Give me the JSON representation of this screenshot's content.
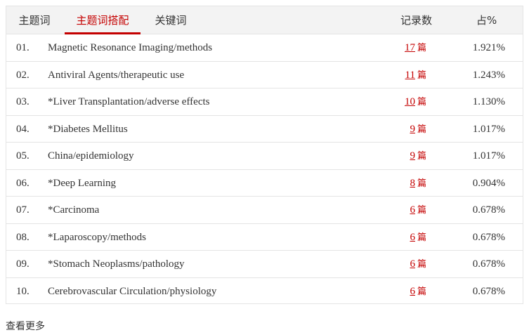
{
  "tabs": [
    {
      "label": "主题词"
    },
    {
      "label": "主题词搭配"
    },
    {
      "label": "关键词"
    }
  ],
  "columns": {
    "count": "记录数",
    "percent": "占%"
  },
  "unit": "篇",
  "rows": [
    {
      "num": "01.",
      "term": "Magnetic Resonance Imaging/methods",
      "count": "17",
      "pct": "1.921%"
    },
    {
      "num": "02.",
      "term": "Antiviral Agents/therapeutic use",
      "count": "11",
      "pct": "1.243%"
    },
    {
      "num": "03.",
      "term": "*Liver Transplantation/adverse effects",
      "count": "10",
      "pct": "1.130%"
    },
    {
      "num": "04.",
      "term": "*Diabetes Mellitus",
      "count": "9",
      "pct": "1.017%"
    },
    {
      "num": "05.",
      "term": "China/epidemiology",
      "count": "9",
      "pct": "1.017%"
    },
    {
      "num": "06.",
      "term": "*Deep Learning",
      "count": "8",
      "pct": "0.904%"
    },
    {
      "num": "07.",
      "term": "*Carcinoma",
      "count": "6",
      "pct": "0.678%"
    },
    {
      "num": "08.",
      "term": "*Laparoscopy/methods",
      "count": "6",
      "pct": "0.678%"
    },
    {
      "num": "09.",
      "term": "*Stomach Neoplasms/pathology",
      "count": "6",
      "pct": "0.678%"
    },
    {
      "num": "10.",
      "term": "Cerebrovascular Circulation/physiology",
      "count": "6",
      "pct": "0.678%"
    }
  ],
  "more_link": "查看更多",
  "colors": {
    "accent": "#c40000",
    "header_bg": "#f3f3f3",
    "border": "#e4e4e4"
  }
}
